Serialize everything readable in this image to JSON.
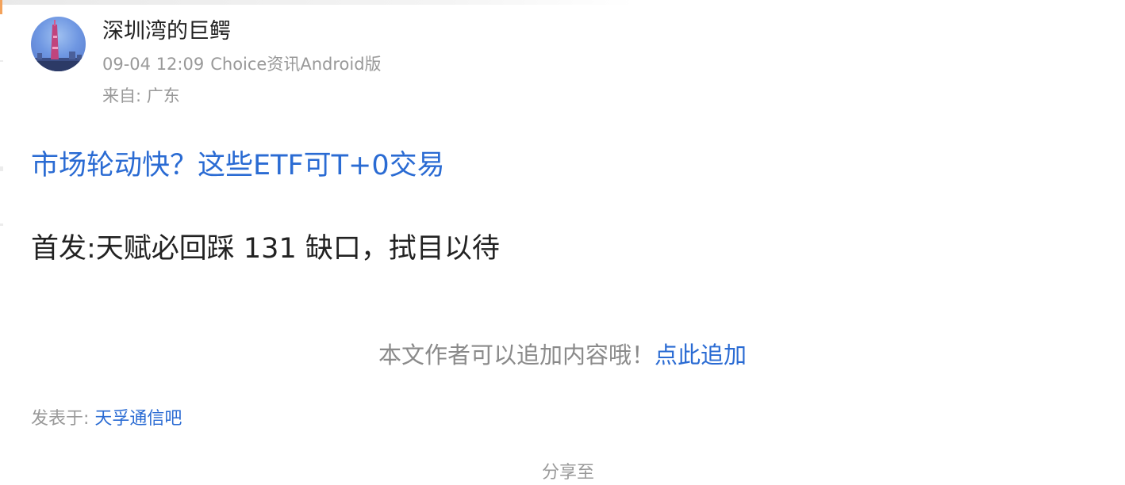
{
  "author": {
    "name": "深圳湾的巨鳄",
    "avatar_icon": "tv-tower-avatar"
  },
  "meta": {
    "datetime": "09-04 12:09",
    "client": "Choice资讯Android版",
    "location": "来自: 广东"
  },
  "post": {
    "link_title": "市场轮动快？这些ETF可T+0交易",
    "body": "首发:天赋必回踩 131 缺口，拭目以待"
  },
  "add_content": {
    "hint": "本文作者可以追加内容哦！",
    "link": "点此追加"
  },
  "posted_in": {
    "label": "发表于: ",
    "forum": "天孚通信吧"
  },
  "share": {
    "label": "分享至"
  },
  "colors": {
    "link_blue": "#2a6bd3",
    "muted_gray": "#999999",
    "text_dark": "#222222"
  }
}
